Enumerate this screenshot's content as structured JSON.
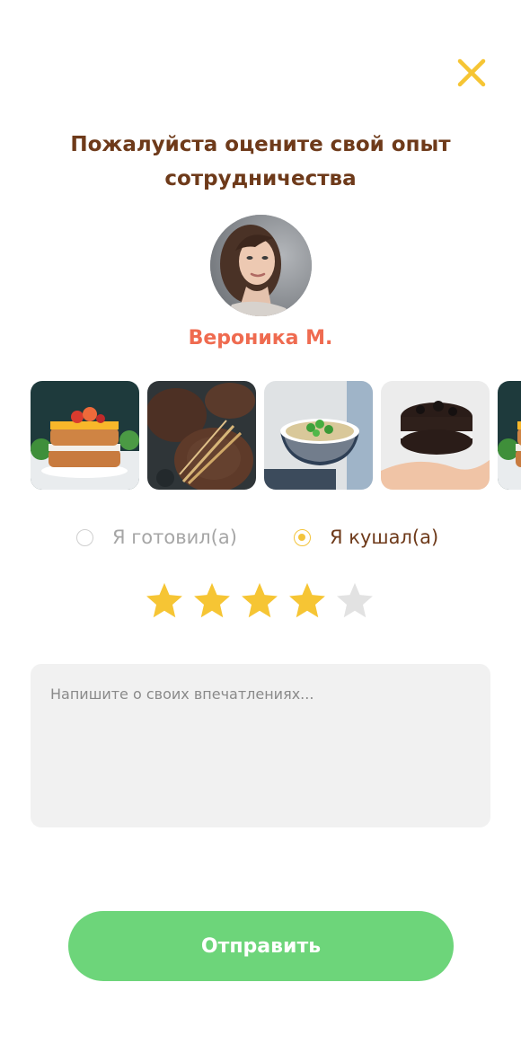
{
  "header": {
    "title_line1": "Пожалуйста оцените свой опыт",
    "title_line2": "сотрудничества",
    "close_icon": "close-icon"
  },
  "profile": {
    "name": "Вероника М.",
    "avatar": "avatar-photo"
  },
  "dishes": [
    {
      "name": "layered-cake-photo"
    },
    {
      "name": "rye-bread-photo"
    },
    {
      "name": "soup-bowl-photo"
    },
    {
      "name": "chocolate-cake-photo"
    },
    {
      "name": "layered-cake-photo-partial"
    }
  ],
  "role_options": [
    {
      "label": "Я готовил(а)",
      "selected": false
    },
    {
      "label": "Я кушал(а)",
      "selected": true
    }
  ],
  "rating": {
    "value": 4,
    "max": 5
  },
  "comment": {
    "placeholder": "Напишите о своих впечатлениях...",
    "value": ""
  },
  "submit": {
    "label": "Отправить"
  },
  "colors": {
    "title": "#6e3a1a",
    "name": "#ef6b50",
    "accent": "#f3c43c",
    "star_on": "#f6c534",
    "star_off": "#e2e2e2",
    "submit_bg": "#6dd57a",
    "input_bg": "#f1f1f1"
  }
}
